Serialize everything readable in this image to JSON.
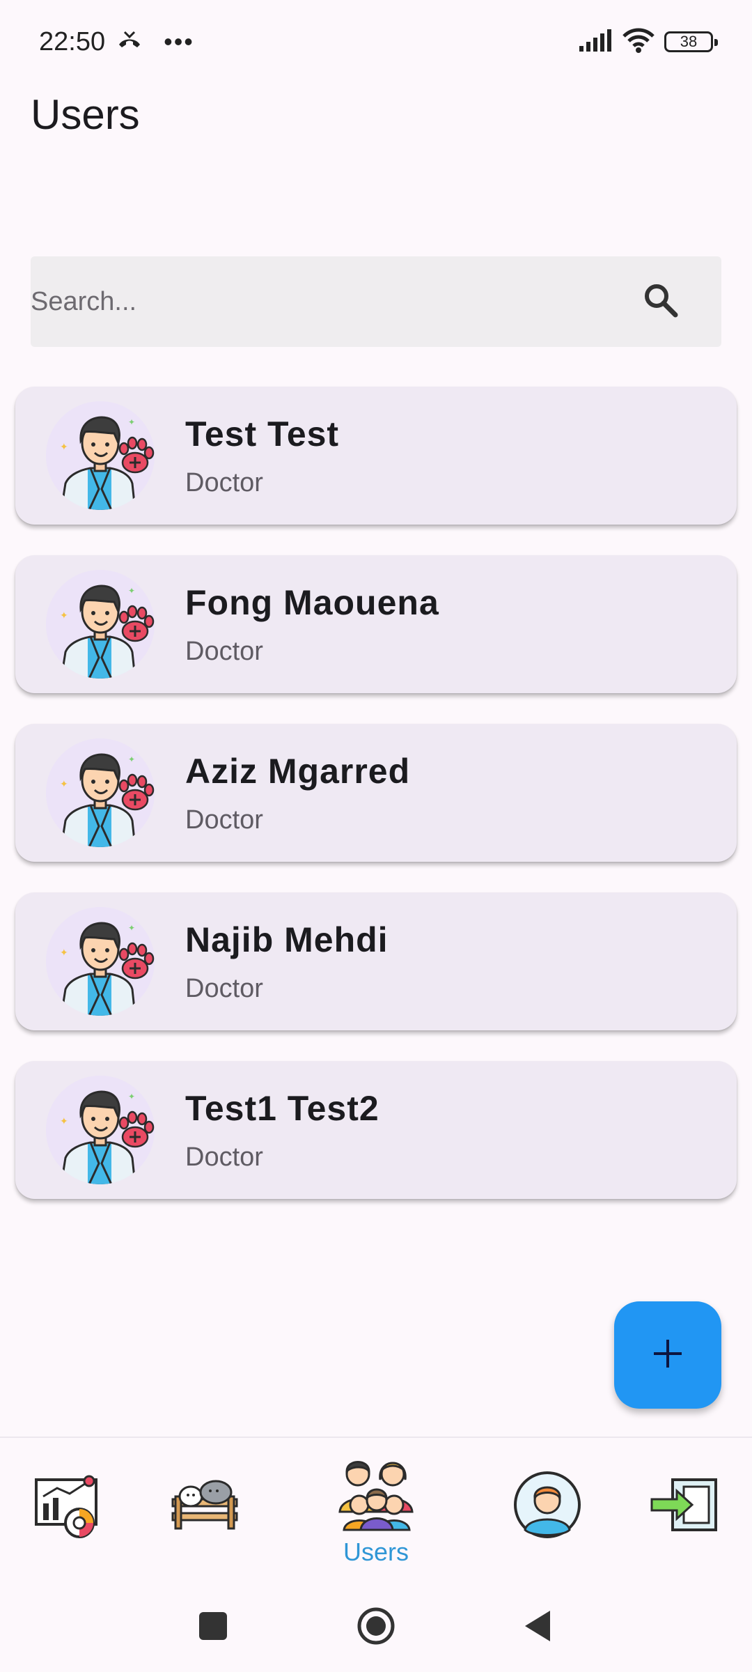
{
  "status_bar": {
    "time": "22:50",
    "battery": "38",
    "icons": [
      "missed-call-icon",
      "more-dots-icon",
      "signal-icon",
      "wifi-icon",
      "battery-icon"
    ]
  },
  "page": {
    "title": "Users"
  },
  "search": {
    "placeholder": "Search...",
    "value": "",
    "icon": "search-icon"
  },
  "users": [
    {
      "name": "Test Test",
      "role": "Doctor"
    },
    {
      "name": "Fong Maouena",
      "role": "Doctor"
    },
    {
      "name": "Aziz Mgarred",
      "role": "Doctor"
    },
    {
      "name": "Najib Mehdi",
      "role": "Doctor"
    },
    {
      "name": "Test1 Test2",
      "role": "Doctor"
    }
  ],
  "fab": {
    "icon": "plus-icon"
  },
  "bottom_nav": {
    "items": [
      {
        "icon": "analytics-icon",
        "label": ""
      },
      {
        "icon": "livestock-icon",
        "label": ""
      },
      {
        "icon": "users-group-icon",
        "label": "Users",
        "active": true
      },
      {
        "icon": "profile-avatar-icon",
        "label": ""
      },
      {
        "icon": "logout-icon",
        "label": ""
      }
    ],
    "active_color": "#2f96d6"
  },
  "colors": {
    "accent": "#2196f3",
    "card_bg": "#efe9f3",
    "page_bg": "#fdf8fc",
    "paw": "#e94a63"
  }
}
